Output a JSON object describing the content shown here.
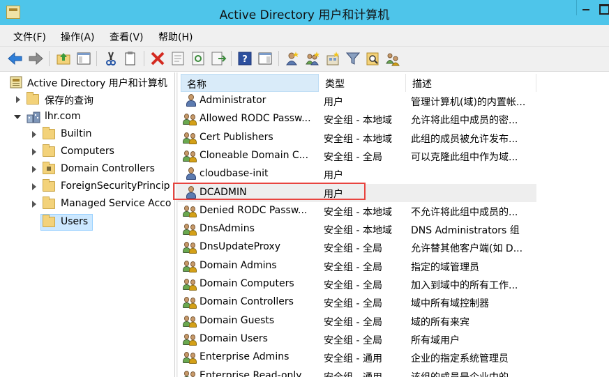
{
  "window": {
    "title": "Active Directory 用户和计算机"
  },
  "menu": [
    "文件(F)",
    "操作(A)",
    "查看(V)",
    "帮助(H)"
  ],
  "toolbar": {
    "icons": [
      "back-arrow-icon",
      "forward-arrow-icon",
      "up-folder-icon",
      "show-console-tree-icon",
      "cut-icon",
      "copy-icon",
      "delete-icon",
      "properties-icon",
      "refresh-icon",
      "export-list-icon",
      "help-icon",
      "action-pane-icon",
      "new-user-icon",
      "new-group-icon",
      "new-ou-icon",
      "filter-icon",
      "find-icon",
      "delegate-control-icon"
    ]
  },
  "tree": {
    "root": "Active Directory 用户和计算机",
    "items": [
      {
        "label": "保存的查询",
        "level": 1,
        "expander": "collapsed"
      },
      {
        "label": "lhr.com",
        "level": 1,
        "expander": "expanded"
      },
      {
        "label": "Builtin",
        "level": 2,
        "expander": "collapsed"
      },
      {
        "label": "Computers",
        "level": 2,
        "expander": "collapsed"
      },
      {
        "label": "Domain Controllers",
        "level": 2,
        "expander": "collapsed"
      },
      {
        "label": "ForeignSecurityPrincip",
        "level": 2,
        "expander": "collapsed"
      },
      {
        "label": "Managed Service Acco",
        "level": 2,
        "expander": "collapsed"
      },
      {
        "label": "Users",
        "level": 2,
        "expander": "none",
        "selected": true
      }
    ]
  },
  "list": {
    "columns": [
      "名称",
      "类型",
      "描述"
    ],
    "rows": [
      {
        "name": "Administrator",
        "type": "用户",
        "desc": "管理计算机(域)的内置帐...",
        "icon": "user"
      },
      {
        "name": "Allowed RODC Passw...",
        "type": "安全组 - 本地域",
        "desc": "允许将此组中成员的密...",
        "icon": "group"
      },
      {
        "name": "Cert Publishers",
        "type": "安全组 - 本地域",
        "desc": "此组的成员被允许发布...",
        "icon": "group"
      },
      {
        "name": "Cloneable Domain C...",
        "type": "安全组 - 全局",
        "desc": "可以克隆此组中作为域...",
        "icon": "group"
      },
      {
        "name": "cloudbase-init",
        "type": "用户",
        "desc": "",
        "icon": "user"
      },
      {
        "name": "DCADMIN",
        "type": "用户",
        "desc": "",
        "icon": "user",
        "highlighted": true
      },
      {
        "name": "Denied RODC Passw...",
        "type": "安全组 - 本地域",
        "desc": "不允许将此组中成员的...",
        "icon": "group"
      },
      {
        "name": "DnsAdmins",
        "type": "安全组 - 本地域",
        "desc": "DNS Administrators 组",
        "icon": "group"
      },
      {
        "name": "DnsUpdateProxy",
        "type": "安全组 - 全局",
        "desc": "允许替其他客户端(如 D...",
        "icon": "group"
      },
      {
        "name": "Domain Admins",
        "type": "安全组 - 全局",
        "desc": "指定的域管理员",
        "icon": "group"
      },
      {
        "name": "Domain Computers",
        "type": "安全组 - 全局",
        "desc": "加入到域中的所有工作...",
        "icon": "group"
      },
      {
        "name": "Domain Controllers",
        "type": "安全组 - 全局",
        "desc": "域中所有域控制器",
        "icon": "group"
      },
      {
        "name": "Domain Guests",
        "type": "安全组 - 全局",
        "desc": "域的所有来宾",
        "icon": "group"
      },
      {
        "name": "Domain Users",
        "type": "安全组 - 全局",
        "desc": "所有域用户",
        "icon": "group"
      },
      {
        "name": "Enterprise Admins",
        "type": "安全组 - 通用",
        "desc": "企业的指定系统管理员",
        "icon": "group"
      },
      {
        "name": "Enterprise Read-only",
        "type": "安全组 - 通用",
        "desc": "该组的成员是企业中的...",
        "icon": "group"
      }
    ]
  },
  "colors": {
    "titlebar": "#4ec5ea",
    "highlight": "#e8443f",
    "selection": "#cce8ff"
  }
}
